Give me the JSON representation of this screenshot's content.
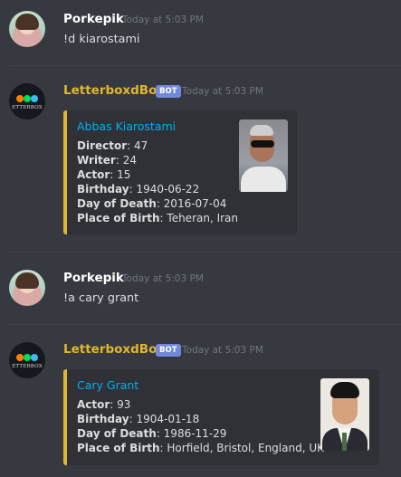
{
  "messages": [
    {
      "author": "Porkepik",
      "timestamp": "Today at 5:03 PM",
      "content": "!d kiarostami"
    },
    {
      "author": "LetterboxdBot",
      "bot_tag": "BOT",
      "avatar_text": "ETTERBOX",
      "timestamp": "Today at 5:03 PM",
      "embed": {
        "title": "Abbas Kiarostami",
        "fields": [
          {
            "name": "Director",
            "value": ": 47"
          },
          {
            "name": "Writer",
            "value": ": 24"
          },
          {
            "name": "Actor",
            "value": ": 15"
          },
          {
            "name": "Birthday",
            "value": ": 1940-06-22"
          },
          {
            "name": "Day of Death",
            "value": ": 2016-07-04"
          },
          {
            "name": "Place of Birth",
            "value": ": Teheran, Iran"
          }
        ]
      }
    },
    {
      "author": "Porkepik",
      "timestamp": "Today at 5:03 PM",
      "content": "!a cary grant"
    },
    {
      "author": "LetterboxdBot",
      "bot_tag": "BOT",
      "avatar_text": "ETTERBOX",
      "timestamp": "Today at 5:03 PM",
      "embed": {
        "title": "Cary Grant",
        "fields": [
          {
            "name": "Actor",
            "value": ": 93"
          },
          {
            "name": "Birthday",
            "value": ": 1904-01-18"
          },
          {
            "name": "Day of Death",
            "value": ": 1986-11-29"
          },
          {
            "name": "Place of Birth",
            "value": ": Horfield, Bristol, England, UK"
          }
        ]
      }
    }
  ],
  "colors": {
    "background": "#36393f",
    "bot_name": "#e0b62f",
    "embed_accent": "#e0b62f",
    "embed_title": "#00b0f4",
    "bot_tag": "#7289da"
  }
}
